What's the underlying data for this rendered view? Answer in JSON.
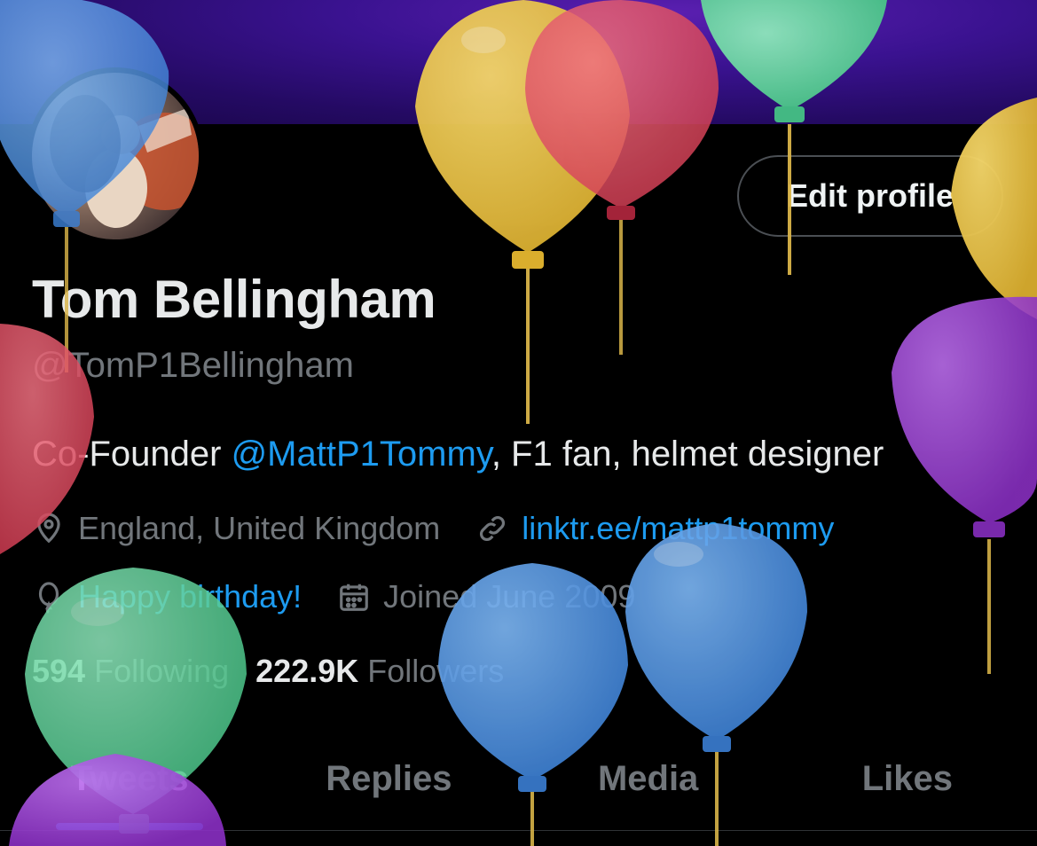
{
  "profile": {
    "name": "Tom Bellingham",
    "handle": "@TomP1Bellingham",
    "edit_label": "Edit profile",
    "bio_prefix": "Co-Founder ",
    "bio_mention": "@MattP1Tommy",
    "bio_suffix": ", F1 fan, helmet designer",
    "location": "England, United Kingdom",
    "website": "linktr.ee/mattp1tommy",
    "birthday": "Happy birthday!",
    "joined": "Joined June 2009",
    "following_count": "594",
    "following_label": "Following",
    "followers_count": "222.9K",
    "followers_label": "Followers"
  },
  "tabs": [
    {
      "label": "Tweets"
    },
    {
      "label": "Replies"
    },
    {
      "label": "Media"
    },
    {
      "label": "Likes"
    }
  ],
  "colors": {
    "accent": "#1d9bf0",
    "banner": "#3a1290",
    "balloon_blue": "#4a90e2",
    "balloon_yellow": "#e8c040",
    "balloon_red": "#e04a5e",
    "balloon_green": "#5fd39a",
    "balloon_purple": "#9b3fd0"
  }
}
